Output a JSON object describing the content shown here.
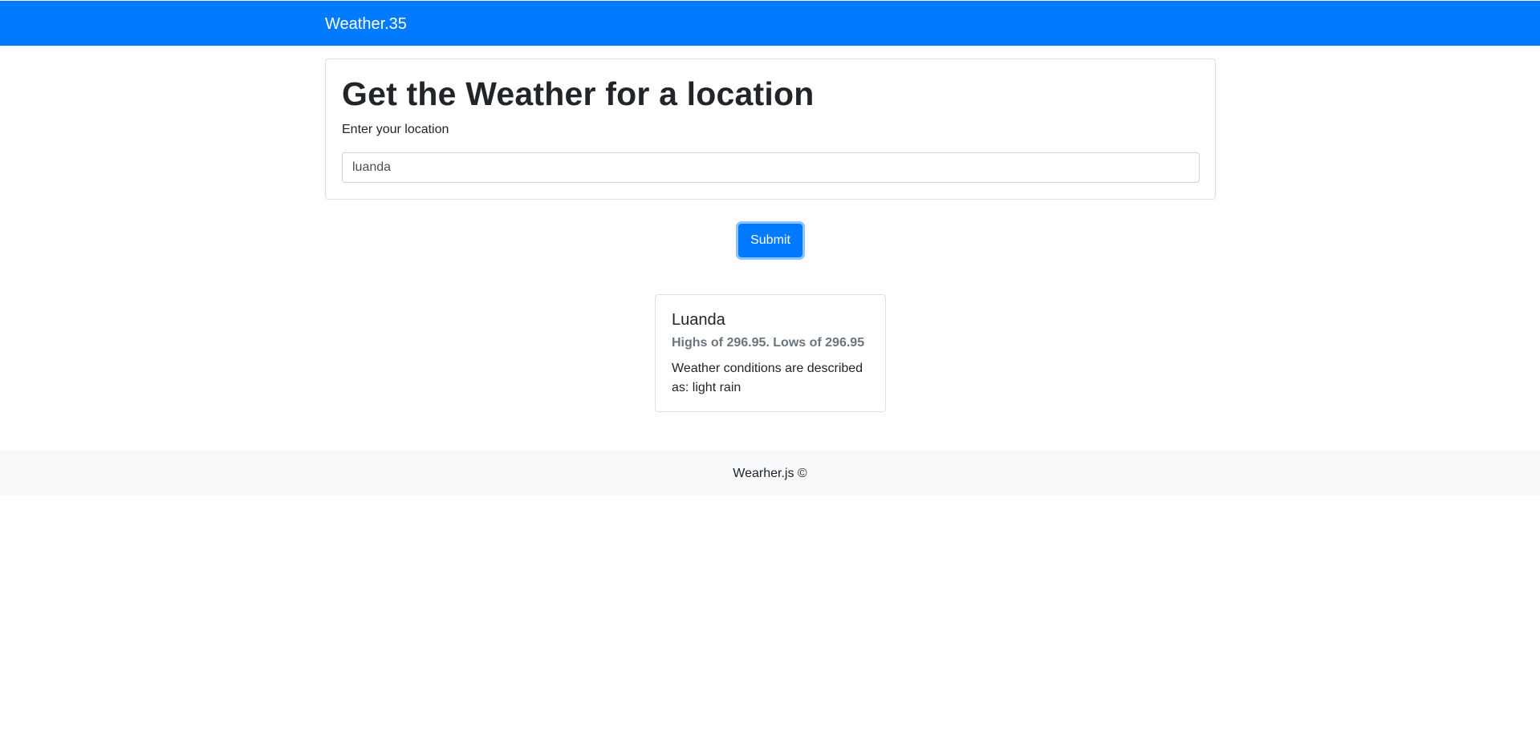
{
  "navbar": {
    "brand": "Weather.35"
  },
  "form": {
    "title": "Get the Weather for a location",
    "label": "Enter your location",
    "location_value": "luanda",
    "submit_label": "Submit"
  },
  "result": {
    "city": "Luanda",
    "temps": "Highs of 296.95. Lows of 296.95",
    "description": "Weather conditions are described as: light rain"
  },
  "footer": {
    "text": "Wearher.js ©"
  },
  "colors": {
    "primary": "#007bff",
    "muted": "#6c757d",
    "footer_bg": "#f8f9fa"
  }
}
